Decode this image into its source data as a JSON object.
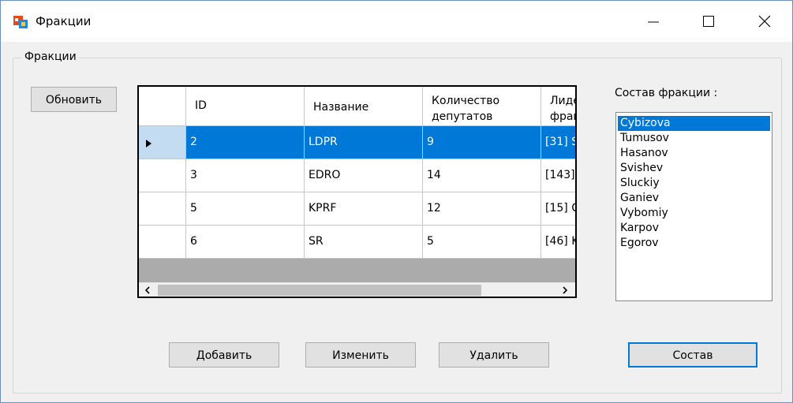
{
  "window": {
    "title": "Фракции",
    "icon": "winforms-app-icon"
  },
  "group": {
    "label": "Фракции"
  },
  "buttons": {
    "refresh": "Обновить",
    "add": "Добавить",
    "edit": "Изменить",
    "delete": "Удалить",
    "members": "Состав"
  },
  "grid": {
    "columns": [
      "ID",
      "Название",
      "Количество депутатов",
      "Лидер фракции"
    ],
    "rows": [
      {
        "id": "2",
        "name": "LDPR",
        "count": "9",
        "leader": "[31] S"
      },
      {
        "id": "3",
        "name": "EDRO",
        "count": "14",
        "leader": "[143]"
      },
      {
        "id": "5",
        "name": "KPRF",
        "count": "12",
        "leader": "[15] C"
      },
      {
        "id": "6",
        "name": "SR",
        "count": "5",
        "leader": "[46] K"
      }
    ],
    "selected_row": 0
  },
  "members": {
    "label": "Состав фракции :",
    "items": [
      "Cybizova",
      "Tumusov",
      "Hasanov",
      "Svishev",
      "Sluckiy",
      "Ganiev",
      "Vybomiy",
      "Karpov",
      "Egorov"
    ],
    "selected": "Cybizova"
  },
  "colors": {
    "selection": "#0078d7",
    "row_header_selected": "#c4dcf1",
    "grid_background": "#ababab",
    "form_background": "#f0f0f0"
  }
}
